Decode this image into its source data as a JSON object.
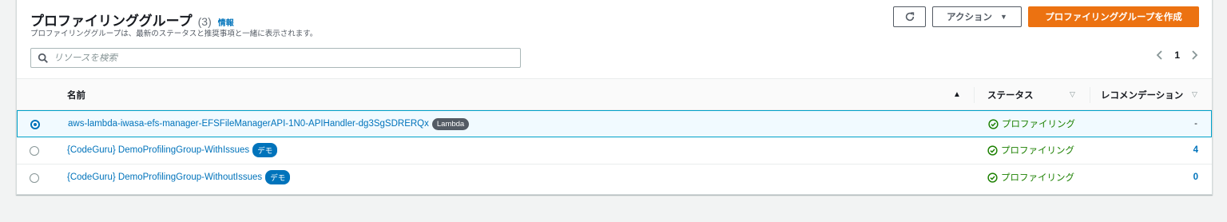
{
  "header": {
    "title": "プロファイリンググループ",
    "count": "(3)",
    "info": "情報",
    "subtitle": "プロファイリンググループは、最新のステータスと推奨事項と一緒に表示されます。"
  },
  "toolbar": {
    "refresh_icon": "refresh-icon",
    "action_label": "アクション",
    "create_label": "プロファイリンググループを作成"
  },
  "search": {
    "placeholder": "リソースを検索",
    "value": ""
  },
  "pagination": {
    "current_page": "1"
  },
  "table": {
    "columns": {
      "name": "名前",
      "status": "ステータス",
      "recommendations": "レコメンデーション"
    },
    "rows": [
      {
        "selected": true,
        "name": "aws-lambda-iwasa-efs-manager-EFSFileManagerAPI-1N0-APIHandler-dg3SgSDRERQx",
        "badge": "Lambda",
        "status": "プロファイリング",
        "recommendations": "-"
      },
      {
        "selected": false,
        "name": "{CodeGuru} DemoProfilingGroup-WithIssues",
        "badge": "デモ",
        "status": "プロファイリング",
        "recommendations": "4"
      },
      {
        "selected": false,
        "name": "{CodeGuru} DemoProfilingGroup-WithoutIssues",
        "badge": "デモ",
        "status": "プロファイリング",
        "recommendations": "0"
      }
    ]
  },
  "colors": {
    "accent": "#ec7211",
    "link": "#0073bb",
    "success": "#1d8102",
    "selected_border": "#00a1c9"
  }
}
